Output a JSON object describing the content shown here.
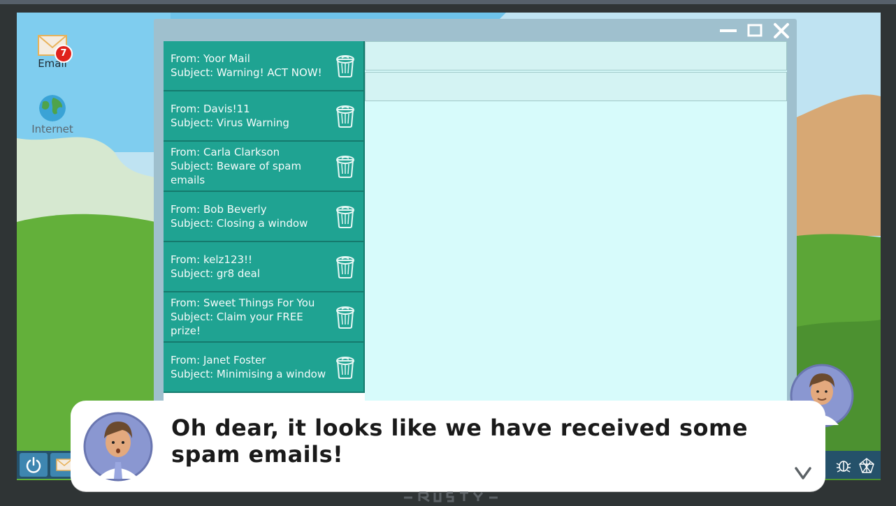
{
  "desktop": {
    "icons": [
      {
        "label": "Email",
        "icon": "envelope-icon",
        "badge": "7"
      },
      {
        "label": "Internet",
        "icon": "globe-icon"
      }
    ]
  },
  "window": {
    "controls": [
      "minimize-icon",
      "maximize-icon",
      "close-icon"
    ],
    "emails": [
      {
        "from": "From: Yoor Mail",
        "subject": "Subject: Warning! ACT NOW!"
      },
      {
        "from": "From: Davis!11",
        "subject": "Subject: Virus Warning"
      },
      {
        "from": "From: Carla Clarkson",
        "subject": "Subject: Beware of spam emails"
      },
      {
        "from": "From: Bob Beverly",
        "subject": "Subject: Closing a window"
      },
      {
        "from": "From: kelz123!!",
        "subject": "Subject: gr8 deal"
      },
      {
        "from": "From: Sweet Things For You",
        "subject": "Subject: Claim your FREE prize!"
      },
      {
        "from": "From: Janet Foster",
        "subject": "Subject: Minimising a window"
      }
    ]
  },
  "dialog": {
    "text": "Oh dear, it looks like we have received some spam emails!",
    "next_icon": "chevron-down-icon"
  },
  "taskbar": {
    "icons": [
      "power-icon",
      "envelope-icon",
      "bug-icon",
      "web-icon"
    ]
  },
  "colors": {
    "email_item": "#1fa392",
    "reading_pane": "#d7fbfb",
    "window_frame": "#9fc0ce",
    "badge": "#e0211b",
    "taskbar": "#25516a"
  }
}
